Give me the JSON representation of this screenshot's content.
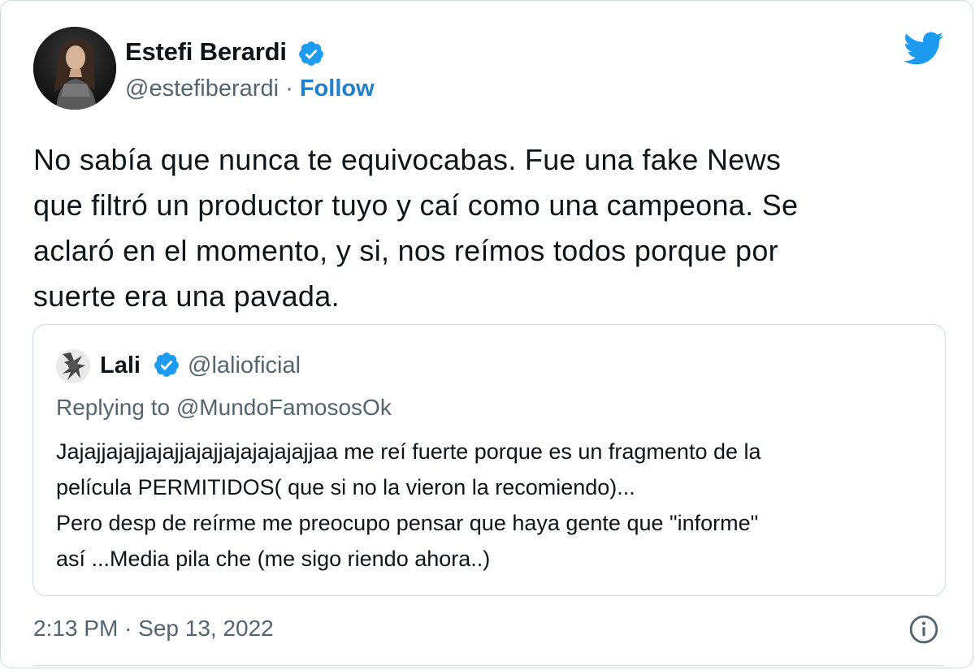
{
  "author": {
    "name": "Estefi Berardi",
    "handle": "@estefiberardi",
    "separator": "·",
    "follow_label": "Follow"
  },
  "icons": {
    "platform": "twitter-bird-icon",
    "verified": "verified-badge-icon",
    "info": "info-icon"
  },
  "tweet": {
    "lines": [
      "No sabía que nunca te equivocabas. Fue una fake News",
      "que filtró un productor tuyo y caí como una campeona. Se",
      "aclaró en el momento, y si, nos reímos todos porque por",
      "suerte era una pavada."
    ],
    "timestamp": "2:13 PM · Sep 13, 2022"
  },
  "quoted": {
    "name": "Lali",
    "handle": "@lalioficial",
    "reply_prefix": "Replying to",
    "reply_to": "@MundoFamososOk",
    "lines": [
      "Jajajjajajjajajjajajjajajajajajjaa me reí fuerte porque es un fragmento de la",
      "película PERMITIDOS( que si no la vieron la recomiendo)...",
      "Pero desp de reírme me preocupo pensar que haya gente que \"informe\"",
      "así ...Media pila che (me sigo riendo ahora..)"
    ]
  },
  "colors": {
    "brand_blue": "#1d9bf0",
    "link_blue": "#1d7fcf",
    "text": "#0f1419",
    "muted": "#536471",
    "border": "#cfd9de"
  }
}
